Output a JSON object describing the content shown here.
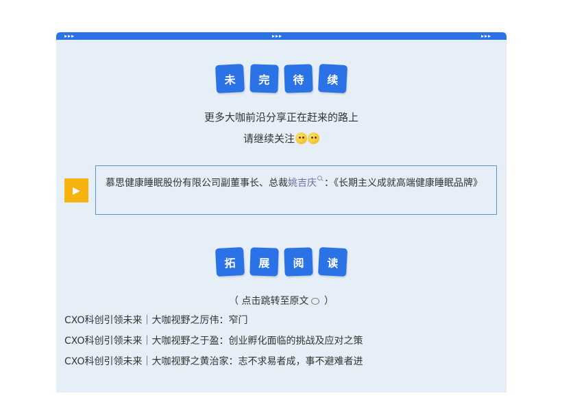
{
  "topbar": {
    "arrows": "▸▸▸"
  },
  "section1": {
    "tiles": [
      "未",
      "完",
      "待",
      "续"
    ],
    "line1": "更多大咖前沿分享正在赶来的路上",
    "line2": "请继续关注"
  },
  "article": {
    "prefix": "慕思健康睡眠股份有限公司副董事长、总裁",
    "person": "姚吉庆",
    "suffix": "：《长期主义成就高端健康睡眠品牌》",
    "play_glyph": "▶"
  },
  "section2": {
    "tiles": [
      "拓",
      "展",
      "阅",
      "读"
    ],
    "hint_open": "（ 点击跳转至原文",
    "hint_close": " ）",
    "links": [
      "CXO科创引领未来｜大咖视野之厉伟：窄门",
      "CXO科创引领未来｜大咖视野之于盈：创业孵化面临的挑战及应对之策",
      "CXO科创引领未来｜大咖视野之黄治家：志不求易者成，事不避难者进"
    ]
  },
  "icons": [
    "play-icon",
    "search-icon",
    "speech-bubble-icon",
    "winking-face-icon"
  ],
  "colors": {
    "accent": "#2a72e5",
    "play": "#f6b20f",
    "background": "#e6eff7"
  }
}
